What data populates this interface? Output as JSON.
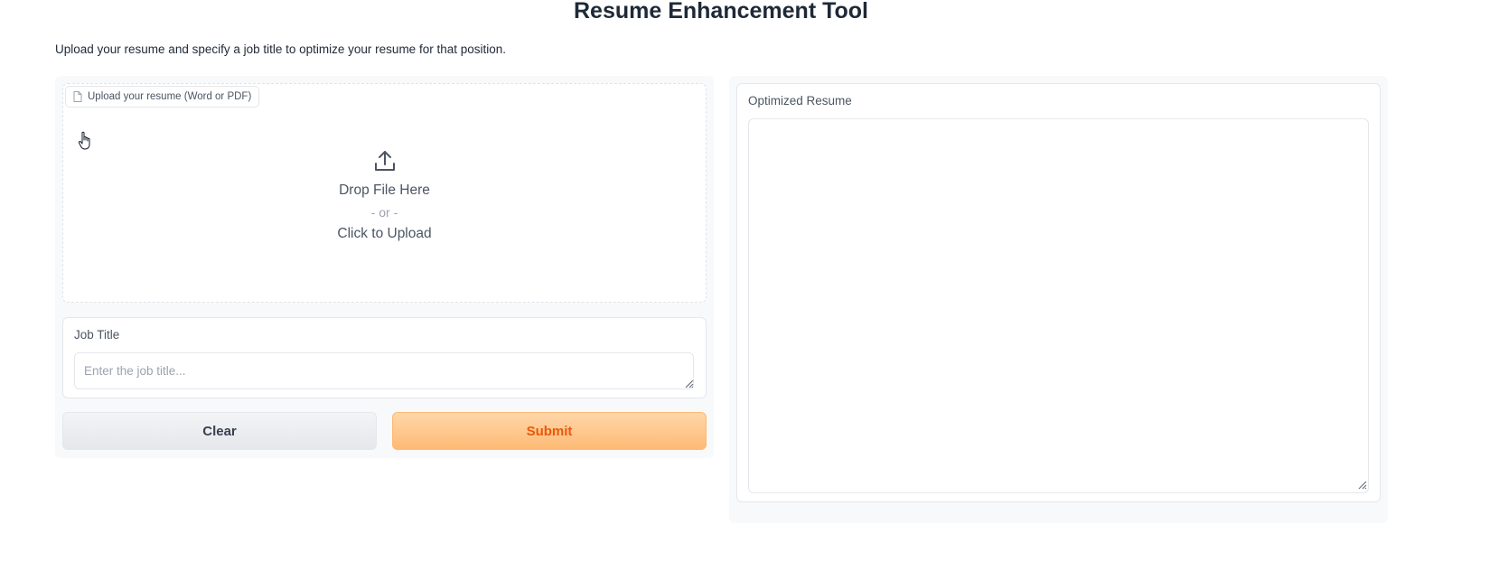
{
  "header": {
    "title": "Resume Enhancement Tool",
    "description": "Upload your resume and specify a job title to optimize your resume for that position."
  },
  "upload": {
    "label": "Upload your resume (Word or PDF)",
    "drop_text": "Drop File Here",
    "or_text": "- or -",
    "click_text": "Click to Upload",
    "icon": "upload-icon"
  },
  "job": {
    "label": "Job Title",
    "value": "",
    "placeholder": "Enter the job title..."
  },
  "buttons": {
    "clear": "Clear",
    "submit": "Submit"
  },
  "output": {
    "label": "Optimized Resume",
    "value": ""
  },
  "colors": {
    "accent": "#ea580c",
    "submit_bg": "#fdba74",
    "panel_bg": "#f8f9fb",
    "border": "#e5e7eb"
  }
}
